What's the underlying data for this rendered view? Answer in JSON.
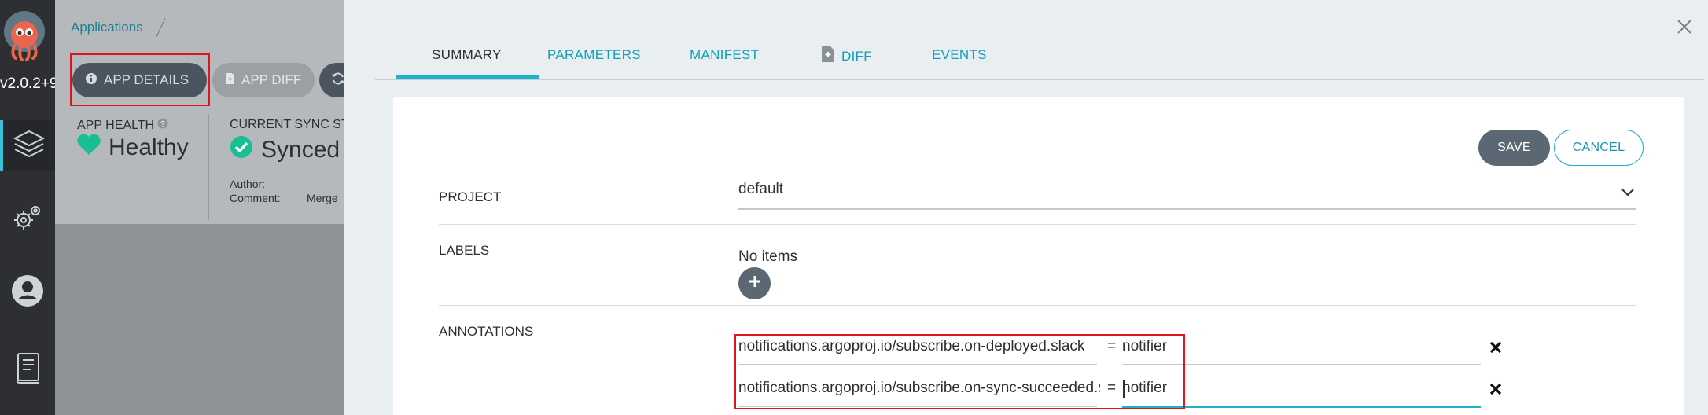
{
  "nav": {
    "version": "v2.0.2+9",
    "items": [
      "applications-icon",
      "settings-icon",
      "user-icon",
      "docs-icon"
    ]
  },
  "app": {
    "breadcrumb": "Applications",
    "toolbar": {
      "app_details": "APP DETAILS",
      "app_diff": "APP DIFF"
    },
    "health": {
      "label": "APP HEALTH",
      "value": "Healthy"
    },
    "sync": {
      "label": "CURRENT SYNC ST",
      "value": "Synced"
    },
    "meta": {
      "author_label": "Author:",
      "comment_label": "Comment:",
      "comment_value": "Merge"
    }
  },
  "drawer": {
    "tabs": [
      {
        "label": "SUMMARY",
        "active": true
      },
      {
        "label": "PARAMETERS",
        "active": false
      },
      {
        "label": "MANIFEST",
        "active": false
      },
      {
        "label": "DIFF",
        "active": false
      },
      {
        "label": "EVENTS",
        "active": false
      }
    ],
    "save": "SAVE",
    "cancel": "CANCEL",
    "project": {
      "label": "PROJECT",
      "value": "default"
    },
    "labels": {
      "label": "LABELS",
      "empty": "No items"
    },
    "annotations": {
      "label": "ANNOTATIONS",
      "eq": "=",
      "items": [
        {
          "key": "notifications.argoproj.io/subscribe.on-deployed.slack",
          "value": "notifier"
        },
        {
          "key": "notifications.argoproj.io/subscribe.on-sync-succeeded.slack",
          "value": "notifier"
        }
      ]
    }
  },
  "colors": {
    "accent": "#1eb0cc",
    "nav_bg": "#2d2f33",
    "healthy": "#18be94",
    "highlight": "#e0161e"
  }
}
